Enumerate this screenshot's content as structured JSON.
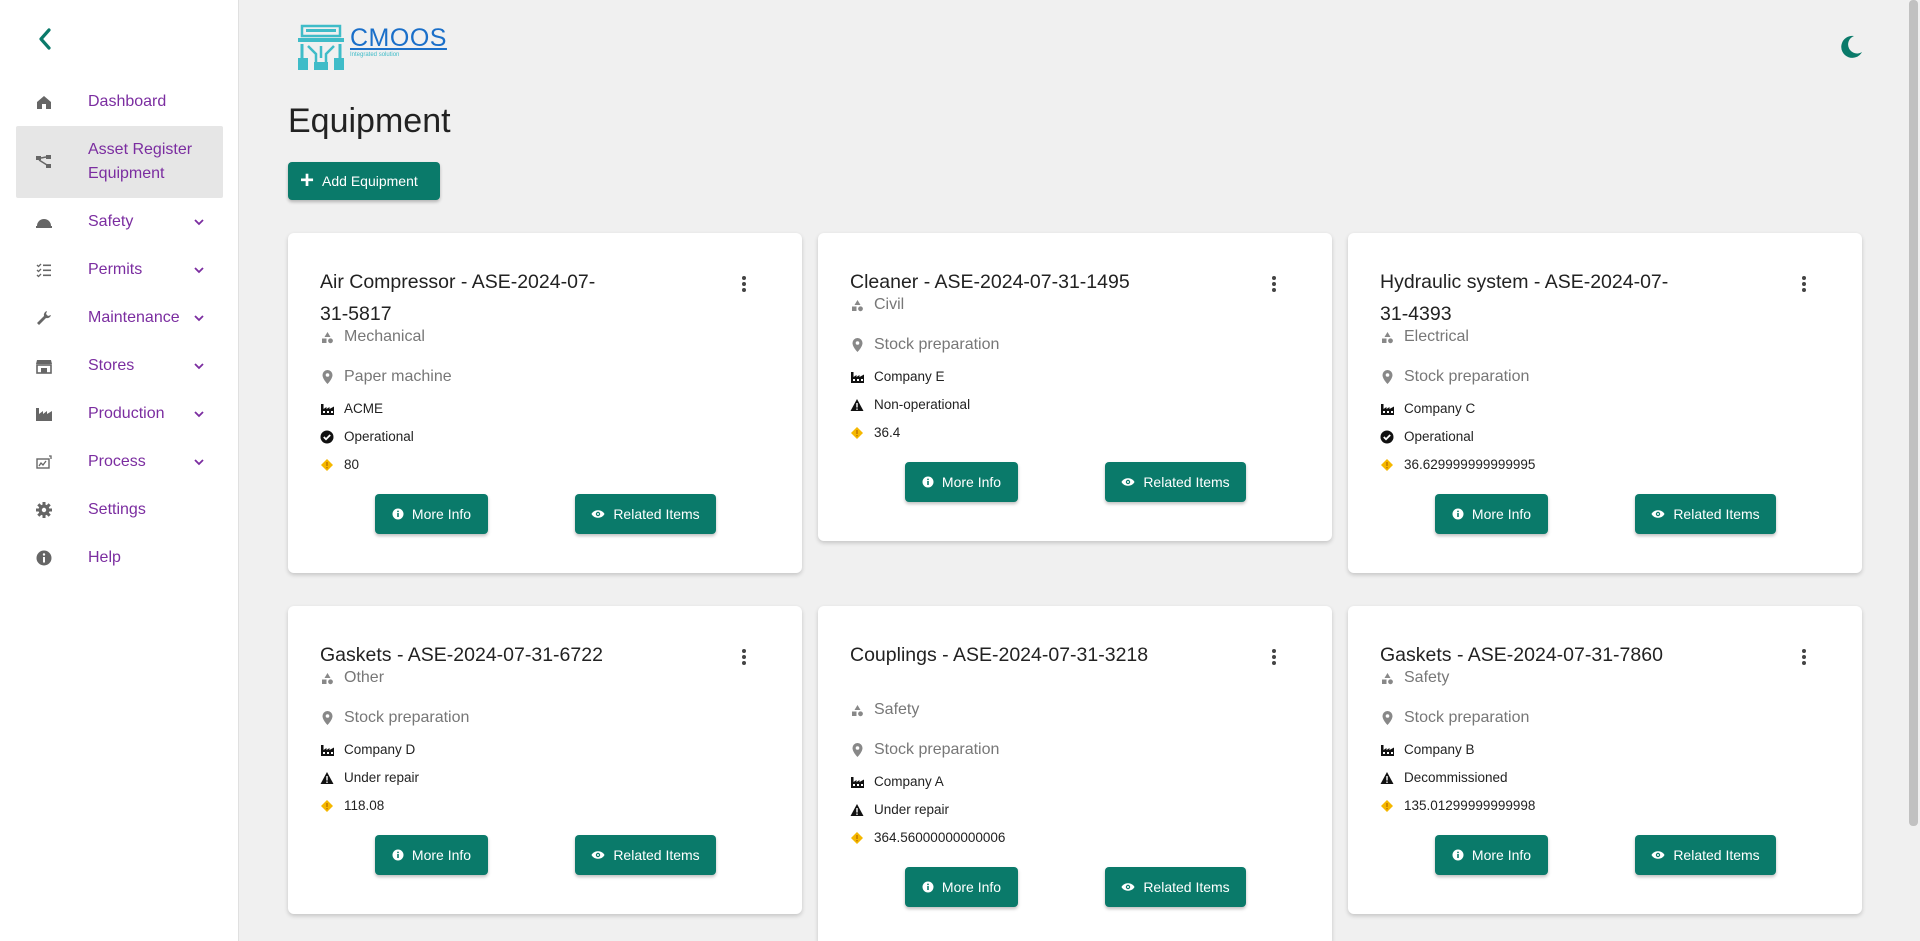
{
  "sidebar": {
    "items": [
      {
        "label": "Dashboard",
        "icon": "home-icon",
        "has_chevron": false,
        "active": false
      },
      {
        "label": "Asset Register Equipment",
        "icon": "hierarchy-icon",
        "has_chevron": false,
        "active": true
      },
      {
        "label": "Safety",
        "icon": "hard-hat-icon",
        "has_chevron": true,
        "active": false
      },
      {
        "label": "Permits",
        "icon": "checklist-icon",
        "has_chevron": true,
        "active": false
      },
      {
        "label": "Maintenance",
        "icon": "wrench-icon",
        "has_chevron": true,
        "active": false
      },
      {
        "label": "Stores",
        "icon": "store-icon",
        "has_chevron": true,
        "active": false
      },
      {
        "label": "Production",
        "icon": "factory-icon",
        "has_chevron": true,
        "active": false
      },
      {
        "label": "Process",
        "icon": "process-icon",
        "has_chevron": true,
        "active": false
      },
      {
        "label": "Settings",
        "icon": "gear-icon",
        "has_chevron": false,
        "active": false
      },
      {
        "label": "Help",
        "icon": "info-icon",
        "has_chevron": false,
        "active": false
      }
    ]
  },
  "header": {
    "logo_title": "CMOOS",
    "logo_subtitle": "Integrated solution"
  },
  "page": {
    "title": "Equipment",
    "add_button": "Add Equipment"
  },
  "buttons": {
    "more_info": "More Info",
    "related_items": "Related Items"
  },
  "cards": [
    {
      "title": "Air Compressor - ASE-2024-07-31-5817",
      "category": "Mechanical",
      "location": "Paper machine",
      "company": "ACME",
      "status": "Operational",
      "status_icon": "check-circle-icon",
      "value": "80"
    },
    {
      "title": "Cleaner - ASE-2024-07-31-1495",
      "category": "Civil",
      "location": "Stock preparation",
      "company": "Company E",
      "status": "Non-operational",
      "status_icon": "warning-icon",
      "value": "36.4"
    },
    {
      "title": "Hydraulic system - ASE-2024-07-31-4393",
      "category": "Electrical",
      "location": "Stock preparation",
      "company": "Company C",
      "status": "Operational",
      "status_icon": "check-circle-icon",
      "value": "36.629999999999995"
    },
    {
      "title": "Gaskets - ASE-2024-07-31-6722",
      "category": "Other",
      "location": "Stock preparation",
      "company": "Company D",
      "status": "Under repair",
      "status_icon": "warning-icon",
      "value": "118.08"
    },
    {
      "title": "Couplings - ASE-2024-07-31-3218",
      "category": "Safety",
      "location": "Stock preparation",
      "company": "Company A",
      "status": "Under repair",
      "status_icon": "warning-icon",
      "value": "364.56000000000006"
    },
    {
      "title": "Gaskets - ASE-2024-07-31-7860",
      "category": "Safety",
      "location": "Stock preparation",
      "company": "Company B",
      "status": "Decommissioned",
      "status_icon": "warning-icon",
      "value": "135.01299999999998"
    }
  ],
  "colors": {
    "accent": "#0a7a6a",
    "nav_text": "#7b2da0",
    "logo_blue": "#1a6fc9",
    "logo_cyan": "#3fbcc8",
    "value_icon": "#f5b800"
  }
}
